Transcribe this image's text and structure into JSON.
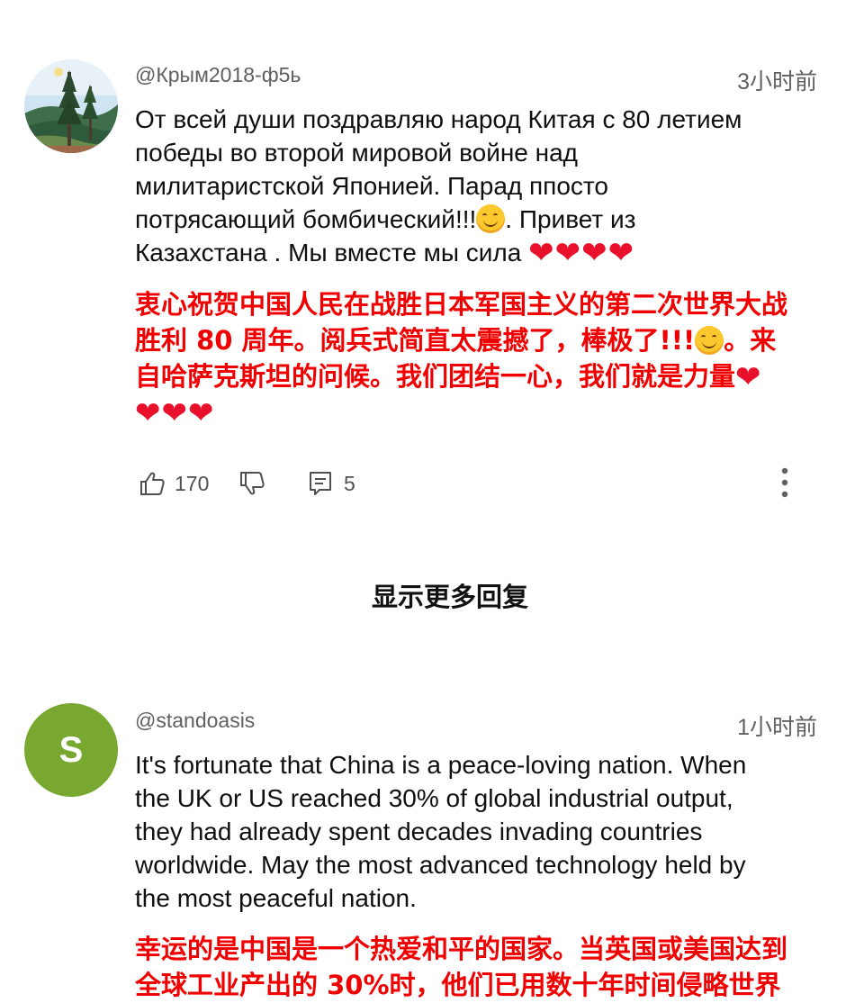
{
  "comments": [
    {
      "handle": "@Крым2018-ф5ь",
      "time": "3小时前",
      "text_lines": [
        "От всей души поздравляю народ Китая с 80 летием",
        "победы во второй мировой войне над",
        "милитаристской Японией.  Парад  ппосто",
        "потрясающий  бомбический!!!",
        ". Привет из",
        "Казахстана . Мы вместе мы сила "
      ],
      "translation_lines": [
        "衷心祝贺中国人民在战胜日本军国主义的第二次世界大战",
        "胜利 80 周年。阅兵式简直太震撼了，棒极了!!!",
        "。来",
        "自哈萨克斯坦的问候。我们团结一心，我们就是力量"
      ],
      "likes": "170",
      "replies": "5"
    },
    {
      "avatar_letter": "S",
      "handle": "@standoasis",
      "time": "1小时前",
      "text_lines": [
        "It's fortunate that China is a peace-loving nation. When",
        "the UK or US reached 30% of global industrial output,",
        "they had already spent decades invading countries",
        "worldwide. May the most advanced technology held by",
        "the most peaceful nation."
      ],
      "translation_lines": [
        "幸运的是中国是一个热爱和平的国家。当英国或美国达到",
        "全球工业产出的 30%时，他们已用数十年时间侵略世界"
      ]
    }
  ],
  "show_more_replies": "显示更多回复",
  "icons": {
    "like": "thumbs-up-icon",
    "dislike": "thumbs-down-icon",
    "reply": "reply-icon",
    "more": "more-vertical-icon",
    "emoji_smile": "smiling-face-emoji",
    "emoji_heart": "red-heart-emoji"
  },
  "colors": {
    "translation_text": "#f00000",
    "meta_text": "#606060",
    "s_avatar_bg": "#78a82f",
    "heart": "#e8102a"
  }
}
